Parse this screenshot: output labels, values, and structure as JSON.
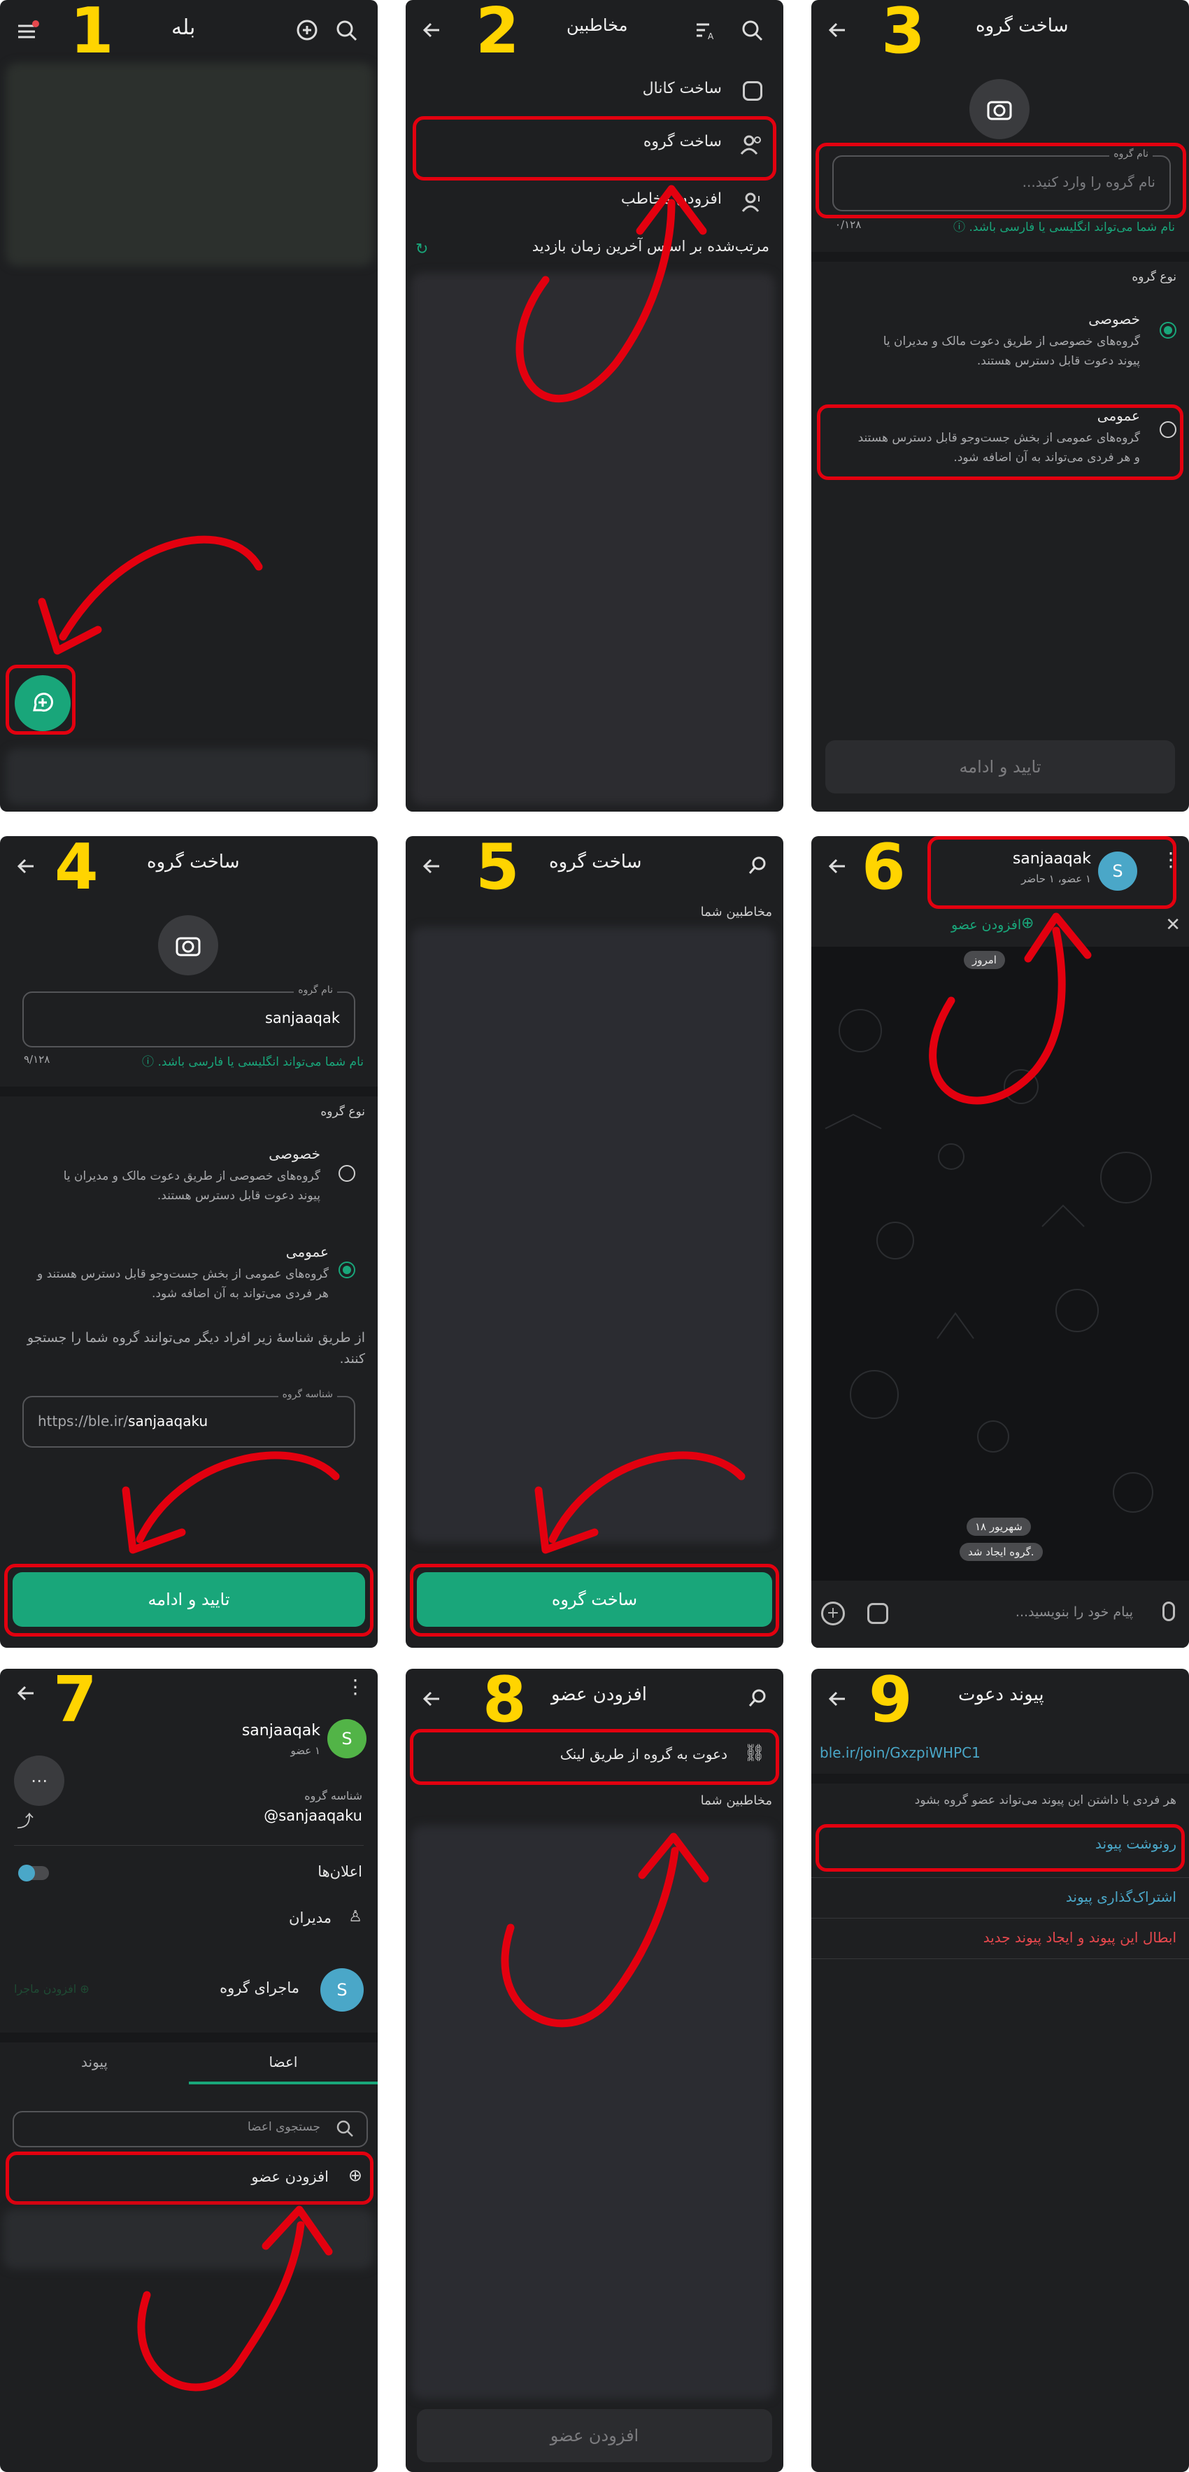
{
  "colors": {
    "accent": "#19a67a",
    "annotation": "#e3000f",
    "step_number": "#ffd400",
    "panel_bg": "#1e1f21"
  },
  "steps": {
    "s1": {
      "number": "1",
      "app_title": "بله",
      "icons": [
        "menu-icon",
        "new-chat-icon",
        "search-icon"
      ]
    },
    "s2": {
      "number": "2",
      "title": "مخاطبین",
      "create_channel": "ساخت کانال",
      "create_group": "ساخت گروه",
      "add_contact": "افزودن مخاطب",
      "sort_text": "مرتب‌شده بر اساس آخرین زمان بازدید"
    },
    "s3": {
      "number": "3",
      "title": "ساخت گروه",
      "name_label": "نام گروه",
      "name_placeholder": "نام گروه را وارد کنید...",
      "counter": "۰/۱۲۸",
      "name_hint": "نام شما می‌تواند انگلیسی یا فارسی باشد.",
      "group_type": "نوع گروه",
      "private_title": "خصوصی",
      "private_desc": "گروه‌های خصوصی از طریق دعوت مالک و مدیران یا پیوند دعوت قابل دسترس هستند.",
      "public_title": "عمومی",
      "public_desc": "گروه‌های عمومی از بخش جست‌وجو قابل دسترس هستند و هر فردی می‌تواند به آن اضافه شود.",
      "confirm": "تایید و ادامه"
    },
    "s4": {
      "number": "4",
      "title": "ساخت گروه",
      "name_label": "نام گروه",
      "name_value": "sanjaaqak",
      "counter": "۹/۱۲۸",
      "name_hint": "نام شما می‌تواند انگلیسی یا فارسی باشد.",
      "group_type": "نوع گروه",
      "private_title": "خصوصی",
      "private_desc": "گروه‌های خصوصی از طریق دعوت مالک و مدیران یا پیوند دعوت قابل دسترس هستند.",
      "public_title": "عمومی",
      "public_desc": "گروه‌های عمومی از بخش جست‌وجو قابل دسترس هستند و هر فردی می‌تواند به آن اضافه شود.",
      "id_info": "از طریق شناسهٔ زیر افراد دیگر می‌توانند گروه شما را جستجو کنند.",
      "id_label": "شناسه گروه",
      "id_prefix": "https://ble.ir/",
      "id_value": "sanjaaqaku",
      "confirm": "تایید و ادامه"
    },
    "s5": {
      "number": "5",
      "title": "ساخت گروه",
      "your_contacts": "مخاطبین شما",
      "create_button": "ساخت گروه"
    },
    "s6": {
      "number": "6",
      "group_name": "sanjaaqak",
      "status": "۱ عضو، ۱ حاضر",
      "avatar_letter": "S",
      "add_member": "افزودن عضو",
      "today": "امروز",
      "date": "۱۸ شهریور",
      "created": "گروه ایجاد شد.",
      "message_placeholder": "پیام خود را بنویسید..."
    },
    "s7": {
      "number": "7",
      "group_name": "sanjaaqak",
      "members_count": "۱ عضو",
      "avatar_letter": "S",
      "id_label": "شناسه گروه",
      "id_value": "@sanjaaqaku",
      "notifications": "اعلان‌ها",
      "admins": "مدیران",
      "adventure": "ماجرای گروه",
      "add_adventure": "افزودن ماجرا",
      "tab_members": "اعضا",
      "tab_link": "پیوند",
      "search_members": "جستجوی اعضا",
      "add_member": "افزودن عضو"
    },
    "s8": {
      "number": "8",
      "title": "افزودن عضو",
      "invite_link": "دعوت به گروه از طریق لینک",
      "your_contacts": "مخاطبین شما",
      "add_member": "افزودن عضو"
    },
    "s9": {
      "number": "9",
      "title": "پیوند دعوت",
      "link": "ble.ir/join/GxzpiWHPC1",
      "info": "هر فردی با داشتن این پیوند می‌تواند عضو گروه بشود",
      "copy_link": "رونوشت پیوند",
      "share_link": "اشتراک‌گذاری پیوند",
      "revoke_link": "ابطال این پیوند و ایجاد پیوند جدید"
    }
  }
}
